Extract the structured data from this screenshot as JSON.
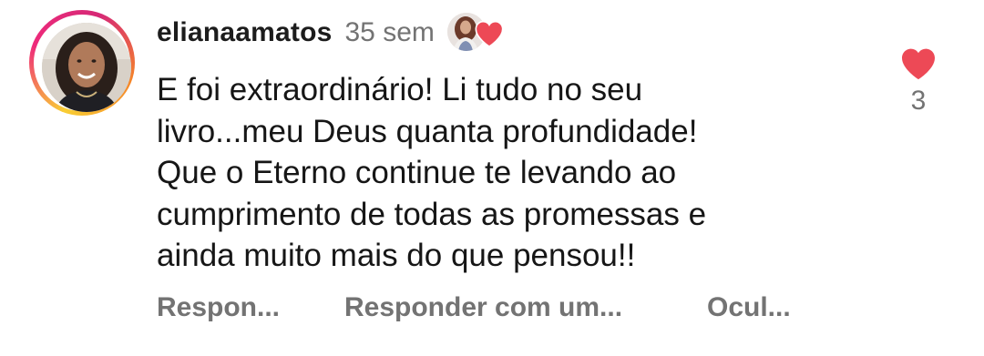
{
  "comment": {
    "username": "elianaamatos",
    "time": "35 sem",
    "text": "E foi extraordinário! Li tudo no seu\nlivro...meu Deus quanta profundidade!\nQue o Eterno continue te levando ao\ncumprimento de todas as promessas e\nainda muito mais do que pensou!!",
    "actions": {
      "reply": "Respon...",
      "reply_gif": "Responder com um...",
      "hide": "Ocul..."
    },
    "like_count": "3"
  },
  "colors": {
    "heart": "#ed4956",
    "muted_text": "#737373",
    "primary_text": "#161616"
  },
  "icons": {
    "author_like": "heart-icon",
    "like": "heart-icon"
  }
}
